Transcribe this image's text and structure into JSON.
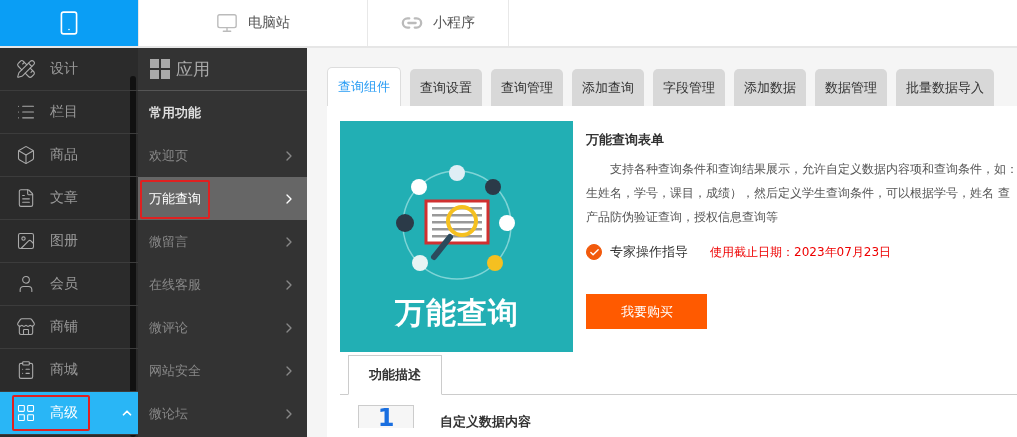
{
  "top_tabs": [
    {
      "kind": "phone",
      "selected": true
    },
    {
      "kind": "monitor",
      "label": "电脑站",
      "selected": false
    },
    {
      "kind": "link",
      "label": "小程序",
      "selected": false
    }
  ],
  "nav": [
    {
      "label": "设计",
      "selected": false,
      "annotated": false,
      "expanded": false
    },
    {
      "label": "栏目",
      "selected": false,
      "annotated": false,
      "expanded": false
    },
    {
      "label": "商品",
      "selected": false,
      "annotated": false,
      "expanded": false
    },
    {
      "label": "文章",
      "selected": false,
      "annotated": false,
      "expanded": false
    },
    {
      "label": "图册",
      "selected": false,
      "annotated": false,
      "expanded": false
    },
    {
      "label": "会员",
      "selected": false,
      "annotated": false,
      "expanded": false
    },
    {
      "label": "商铺",
      "selected": false,
      "annotated": false,
      "expanded": false
    },
    {
      "label": "商城",
      "selected": false,
      "annotated": false,
      "expanded": false
    },
    {
      "label": "高级",
      "selected": true,
      "annotated": true,
      "expanded": true
    }
  ],
  "subnav": {
    "title": "应用",
    "section": "常用功能",
    "items": [
      {
        "label": "欢迎页",
        "selected": false,
        "annotated": false
      },
      {
        "label": "万能查询",
        "selected": true,
        "annotated": true
      },
      {
        "label": "微留言",
        "selected": false,
        "annotated": false
      },
      {
        "label": "在线客服",
        "selected": false,
        "annotated": false
      },
      {
        "label": "微评论",
        "selected": false,
        "annotated": false
      },
      {
        "label": "网站安全",
        "selected": false,
        "annotated": false
      },
      {
        "label": "微论坛",
        "selected": false,
        "annotated": false
      }
    ]
  },
  "tabs": [
    {
      "label": "查询组件",
      "selected": true
    },
    {
      "label": "查询设置",
      "selected": false
    },
    {
      "label": "查询管理",
      "selected": false
    },
    {
      "label": "添加查询",
      "selected": false
    },
    {
      "label": "字段管理",
      "selected": false
    },
    {
      "label": "添加数据",
      "selected": false
    },
    {
      "label": "数据管理",
      "selected": false
    },
    {
      "label": "批量数据导入",
      "selected": false
    }
  ],
  "product": {
    "banner_text": "万能查询",
    "title": "万能查询表单",
    "description_lines": [
      "支持各种查询条件和查询结果展示，允许自定义数据内容项和查询条件，如：",
      "生姓名，学号，课目，成绩），然后定义学生查询条件，可以根据学号，姓名 查",
      "产品防伪验证查询，授权信息查询等"
    ],
    "feature": {
      "label": "专家操作指导",
      "checked": true
    },
    "expiry": "使用截止日期：2023年07月23日",
    "buy": "我要购买"
  },
  "detail_tabs": [
    {
      "label": "功能描述",
      "selected": true
    }
  ],
  "features": [
    {
      "number": "1",
      "title": "自定义数据内容"
    }
  ]
}
